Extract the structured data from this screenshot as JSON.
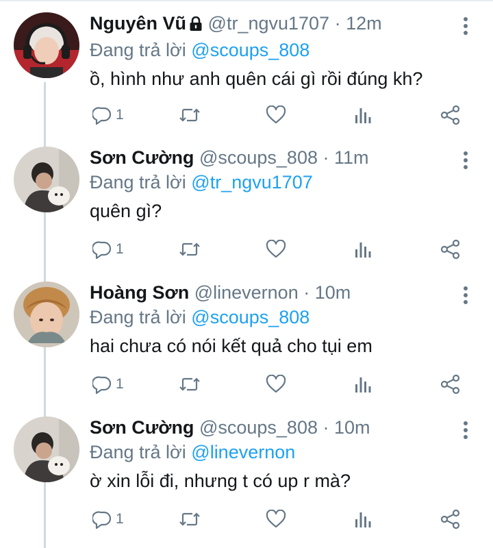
{
  "labels": {
    "replying_to": "Đang trả lời"
  },
  "tweets": [
    {
      "name": "Nguyên Vũ",
      "locked": true,
      "handle": "@tr_ngvu1707",
      "time": "12m",
      "reply_to": "@scoups_808",
      "text": "ồ, hình như anh quên cái gì rồi đúng kh?",
      "reply_count": "1"
    },
    {
      "name": "Sơn Cường",
      "locked": false,
      "handle": "@scoups_808",
      "time": "11m",
      "reply_to": "@tr_ngvu1707",
      "text": "quên gì?",
      "reply_count": "1"
    },
    {
      "name": "Hoàng Sơn",
      "locked": false,
      "handle": "@linevernon",
      "time": "10m",
      "reply_to": "@scoups_808",
      "text": "hai chưa có nói kết quả cho tụi em",
      "reply_count": "1"
    },
    {
      "name": "Sơn Cường",
      "locked": false,
      "handle": "@scoups_808",
      "time": "10m",
      "reply_to": "@linevernon",
      "text": "ờ xin lỗi đi, nhưng t có up r mà?",
      "reply_count": "1"
    }
  ],
  "colors": {
    "text": "#14171a",
    "muted": "#657786",
    "link": "#1da1f2",
    "thread": "#cfd9de"
  },
  "icons": {
    "reply": "reply-icon",
    "retweet": "retweet-icon",
    "like": "heart-icon",
    "analytics": "analytics-icon",
    "share": "share-icon",
    "more": "more-vertical-icon",
    "lock": "lock-icon"
  }
}
